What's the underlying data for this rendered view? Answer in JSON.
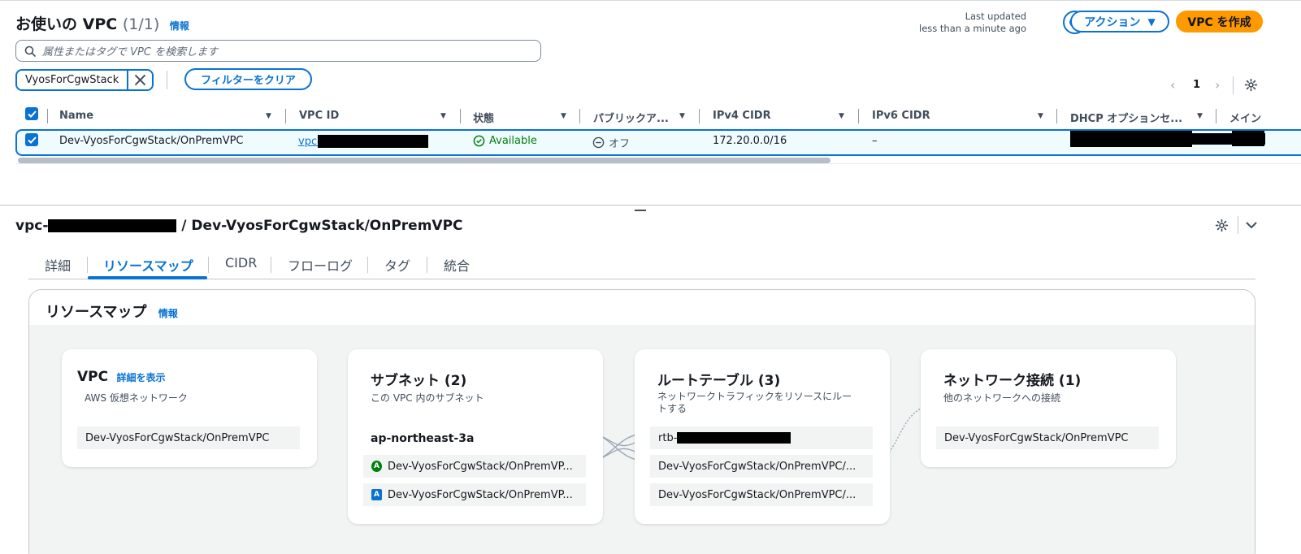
{
  "header": {
    "title": "お使いの VPC",
    "count": "(1/1)",
    "info": "情報",
    "last_updated_label": "Last updated",
    "last_updated_value": "less than a minute ago",
    "actions_label": "アクション",
    "create_label": "VPC を作成"
  },
  "search": {
    "placeholder": "属性またはタグで VPC を検索します"
  },
  "filter": {
    "token": "VyosForCgwStack",
    "clear_label": "フィルターをクリア"
  },
  "pagination": {
    "page": "1"
  },
  "table": {
    "columns": [
      "Name",
      "VPC ID",
      "状態",
      "パブリックア...",
      "IPv4 CIDR",
      "IPv6 CIDR",
      "DHCP オプションセ...",
      "メイン"
    ],
    "rows": [
      {
        "name": "Dev-VyosForCgwStack/OnPremVPC",
        "vpc_id": "vpc-",
        "status": "Available",
        "public": "オフ",
        "ipv4": "172.20.0.0/16",
        "ipv6": "–"
      }
    ]
  },
  "detail": {
    "id_prefix": "vpc-",
    "name": " / Dev-VyosForCgwStack/OnPremVPC",
    "tabs": [
      "詳細",
      "リソースマップ",
      "CIDR",
      "フローログ",
      "タグ",
      "統合"
    ],
    "active_tab": 1
  },
  "resource_map": {
    "title": "リソースマップ",
    "info": "情報",
    "vpc": {
      "title": "VPC",
      "link": "詳細を表示",
      "subtitle": "AWS 仮想ネットワーク",
      "item": "Dev-VyosForCgwStack/OnPremVPC"
    },
    "subnets": {
      "title": "サブネット (2)",
      "subtitle": "この VPC 内のサブネット",
      "az": "ap-northeast-3a",
      "items": [
        {
          "badge": "A",
          "label": "Dev-VyosForCgwStack/OnPremVP...",
          "color": "#037f0c"
        },
        {
          "badge": "A",
          "label": "Dev-VyosForCgwStack/OnPremVP...",
          "color": "#0972d3"
        }
      ]
    },
    "route_tables": {
      "title": "ルートテーブル (3)",
      "subtitle": "ネットワークトラフィックをリソースにルートする",
      "rtb_prefix": "rtb-",
      "items": [
        "Dev-VyosForCgwStack/OnPremVPC/...",
        "Dev-VyosForCgwStack/OnPremVPC/..."
      ]
    },
    "network": {
      "title": "ネットワーク接続 (1)",
      "subtitle": "他のネットワークへの接続",
      "item": "Dev-VyosForCgwStack/OnPremVPC"
    }
  },
  "colors": {
    "accent": "#0972d3",
    "primary": "#ff9900",
    "available": "#037f0c"
  }
}
